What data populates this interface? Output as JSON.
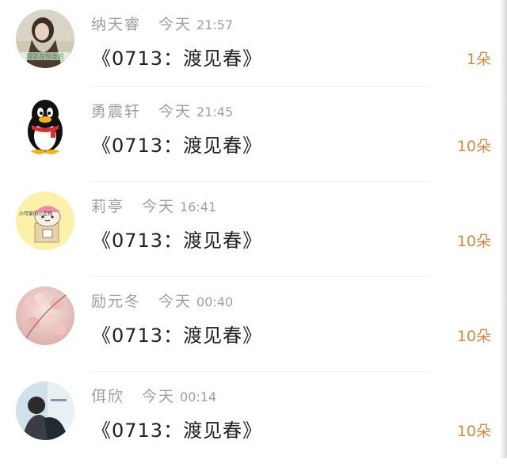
{
  "gifts": [
    {
      "name": "纳天睿",
      "time_label": "今天",
      "time": "21:57",
      "title": "《0713：渡见春》",
      "count": "1朵",
      "avatar_caption": "我就在你身后"
    },
    {
      "name": "勇震轩",
      "time_label": "今天",
      "time": "21:45",
      "title": "《0713：渡见春》",
      "count": "10朵"
    },
    {
      "name": "莉亭",
      "time_label": "今天",
      "time": "16:41",
      "title": "《0713：渡见春》",
      "count": "10朵",
      "avatar_caption": "小可爱的小宝物"
    },
    {
      "name": "励元冬",
      "time_label": "今天",
      "time": "00:40",
      "title": "《0713：渡见春》",
      "count": "10朵"
    },
    {
      "name": "佴欣",
      "time_label": "今天",
      "time": "00:14",
      "title": "《0713：渡见春》",
      "count": "10朵"
    }
  ],
  "colors": {
    "count": "#d9883f",
    "meta": "#9e9e9e",
    "title": "#222222"
  }
}
